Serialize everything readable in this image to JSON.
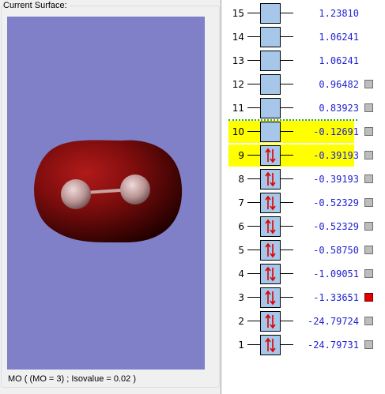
{
  "panel": {
    "title": "Current Surface:",
    "status_text": "MO ( (MO = 3) ; Isovalue = 0.02 )"
  },
  "colors": {
    "viewport_bg": "#8080c8",
    "orbital_surface": "#7a0d0d",
    "highlight": "#ffff00",
    "orbital_box": "#a6c7e9",
    "energy_text": "#1f1fd0",
    "arrow": "#e00000",
    "active_marker": "#e00000",
    "homo_lumo_separator": "#2ea82e"
  },
  "orbitals": [
    {
      "number": "15",
      "energy": "1.23810",
      "occupied": false,
      "highlighted": false,
      "marker": "none"
    },
    {
      "number": "14",
      "energy": "1.06241",
      "occupied": false,
      "highlighted": false,
      "marker": "none"
    },
    {
      "number": "13",
      "energy": "1.06241",
      "occupied": false,
      "highlighted": false,
      "marker": "none"
    },
    {
      "number": "12",
      "energy": "0.96482",
      "occupied": false,
      "highlighted": false,
      "marker": "gray"
    },
    {
      "number": "11",
      "energy": "0.83923",
      "occupied": false,
      "highlighted": false,
      "marker": "gray"
    },
    {
      "number": "10",
      "energy": "-0.12691",
      "occupied": false,
      "highlighted": true,
      "marker": "gray"
    },
    {
      "number": "9",
      "energy": "-0.39193",
      "occupied": true,
      "highlighted": true,
      "marker": "gray"
    },
    {
      "number": "8",
      "energy": "-0.39193",
      "occupied": true,
      "highlighted": false,
      "marker": "gray"
    },
    {
      "number": "7",
      "energy": "-0.52329",
      "occupied": true,
      "highlighted": false,
      "marker": "gray"
    },
    {
      "number": "6",
      "energy": "-0.52329",
      "occupied": true,
      "highlighted": false,
      "marker": "gray"
    },
    {
      "number": "5",
      "energy": "-0.58750",
      "occupied": true,
      "highlighted": false,
      "marker": "gray"
    },
    {
      "number": "4",
      "energy": "-1.09051",
      "occupied": true,
      "highlighted": false,
      "marker": "gray"
    },
    {
      "number": "3",
      "energy": "-1.33651",
      "occupied": true,
      "highlighted": false,
      "marker": "red"
    },
    {
      "number": "2",
      "energy": "-24.79724",
      "occupied": true,
      "highlighted": false,
      "marker": "gray"
    },
    {
      "number": "1",
      "energy": "-24.79731",
      "occupied": true,
      "highlighted": false,
      "marker": "gray"
    }
  ],
  "icons": {
    "electron_pair": "up-down-arrows-icon",
    "marker": "square-toggle-icon"
  }
}
